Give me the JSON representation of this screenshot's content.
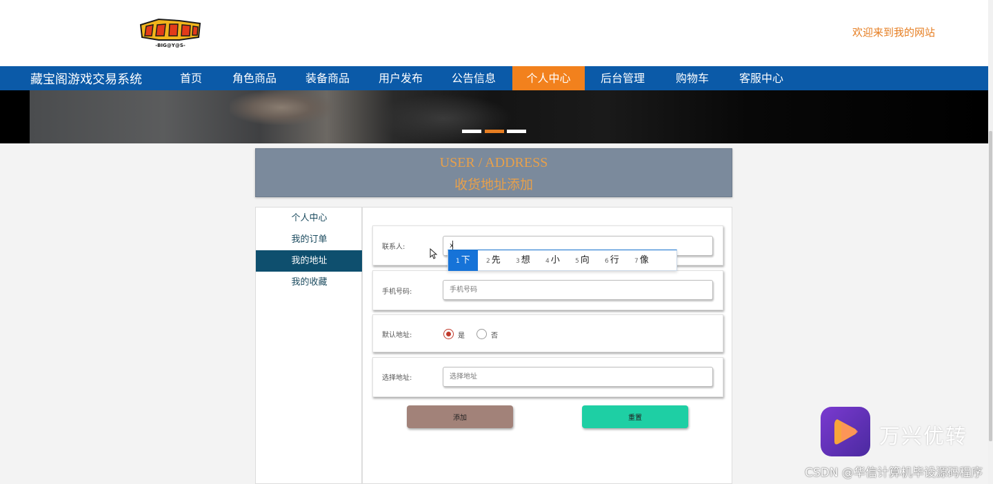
{
  "header": {
    "logo_text": "-BIG@Y@S-",
    "welcome": "欢迎来到我的网站"
  },
  "nav": {
    "brand": "藏宝阁游戏交易系统",
    "items": [
      {
        "label": "首页"
      },
      {
        "label": "角色商品"
      },
      {
        "label": "装备商品"
      },
      {
        "label": "用户发布"
      },
      {
        "label": "公告信息"
      },
      {
        "label": "个人中心",
        "active": true
      },
      {
        "label": "后台管理"
      },
      {
        "label": "购物车"
      },
      {
        "label": "客服中心"
      }
    ]
  },
  "banner": {
    "slide_count": 3,
    "active_slide": 2
  },
  "page_title": {
    "en": "USER / ADDRESS",
    "cn": "收货地址添加"
  },
  "sidebar": {
    "items": [
      {
        "label": "个人中心"
      },
      {
        "label": "我的订单"
      },
      {
        "label": "我的地址",
        "active": true
      },
      {
        "label": "我的收藏"
      }
    ]
  },
  "form": {
    "contact": {
      "label": "联系人:",
      "value": "x"
    },
    "phone": {
      "label": "手机号码:",
      "placeholder": "手机号码"
    },
    "default_address": {
      "label": "默认地址:",
      "options": [
        {
          "label": "是",
          "checked": true
        },
        {
          "label": "否",
          "checked": false
        }
      ]
    },
    "address": {
      "label": "选择地址:",
      "placeholder": "选择地址"
    },
    "add_button": "添加",
    "reset_button": "重置"
  },
  "ime": {
    "candidates": [
      {
        "num": "1",
        "text": "下",
        "selected": true
      },
      {
        "num": "2",
        "text": "先"
      },
      {
        "num": "3",
        "text": "想"
      },
      {
        "num": "4",
        "text": "小"
      },
      {
        "num": "5",
        "text": "向"
      },
      {
        "num": "6",
        "text": "行"
      },
      {
        "num": "7",
        "text": "像"
      }
    ]
  },
  "watermark": {
    "app_name": "万兴优转",
    "credit": "CSDN @华信计算机毕设源码程序"
  },
  "colors": {
    "nav_bg": "#0b5aa8",
    "nav_active": "#f2811d",
    "accent_orange": "#e67e22",
    "sidebar_active": "#0e4f6e",
    "add_button": "#a28279",
    "reset_button": "#1ecfa4"
  }
}
